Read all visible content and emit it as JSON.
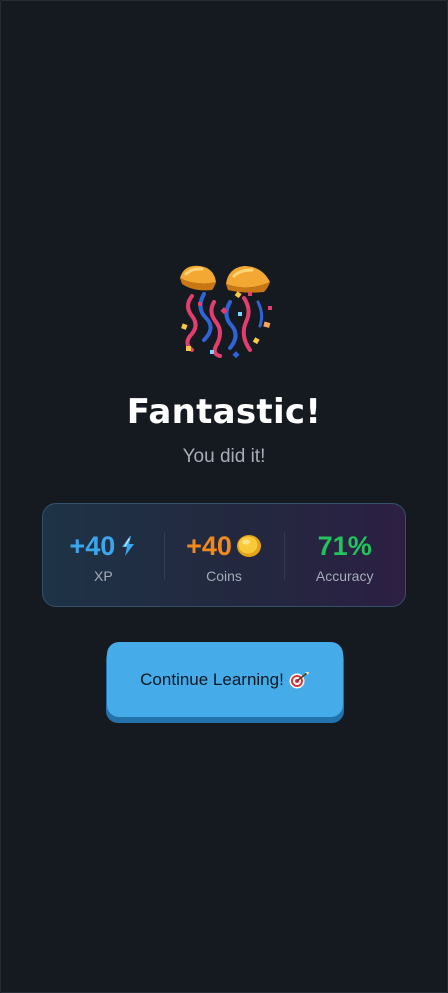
{
  "result": {
    "title": "Fantastic!",
    "subtitle": "You did it!",
    "celebration_icon": "party-popper-icon"
  },
  "stats": [
    {
      "value": "+40",
      "label": "XP",
      "icon": "lightning-icon",
      "color": "#3ba6ee"
    },
    {
      "value": "+40",
      "label": "Coins",
      "icon": "coin-icon",
      "color": "#f08a1e"
    },
    {
      "value": "71%",
      "label": "Accuracy",
      "icon": null,
      "color": "#22c25c"
    }
  ],
  "continue_button": {
    "label": "Continue Learning!",
    "icon": "target-icon",
    "color": "#45ace9"
  },
  "theme": {
    "background": "#151a21"
  }
}
